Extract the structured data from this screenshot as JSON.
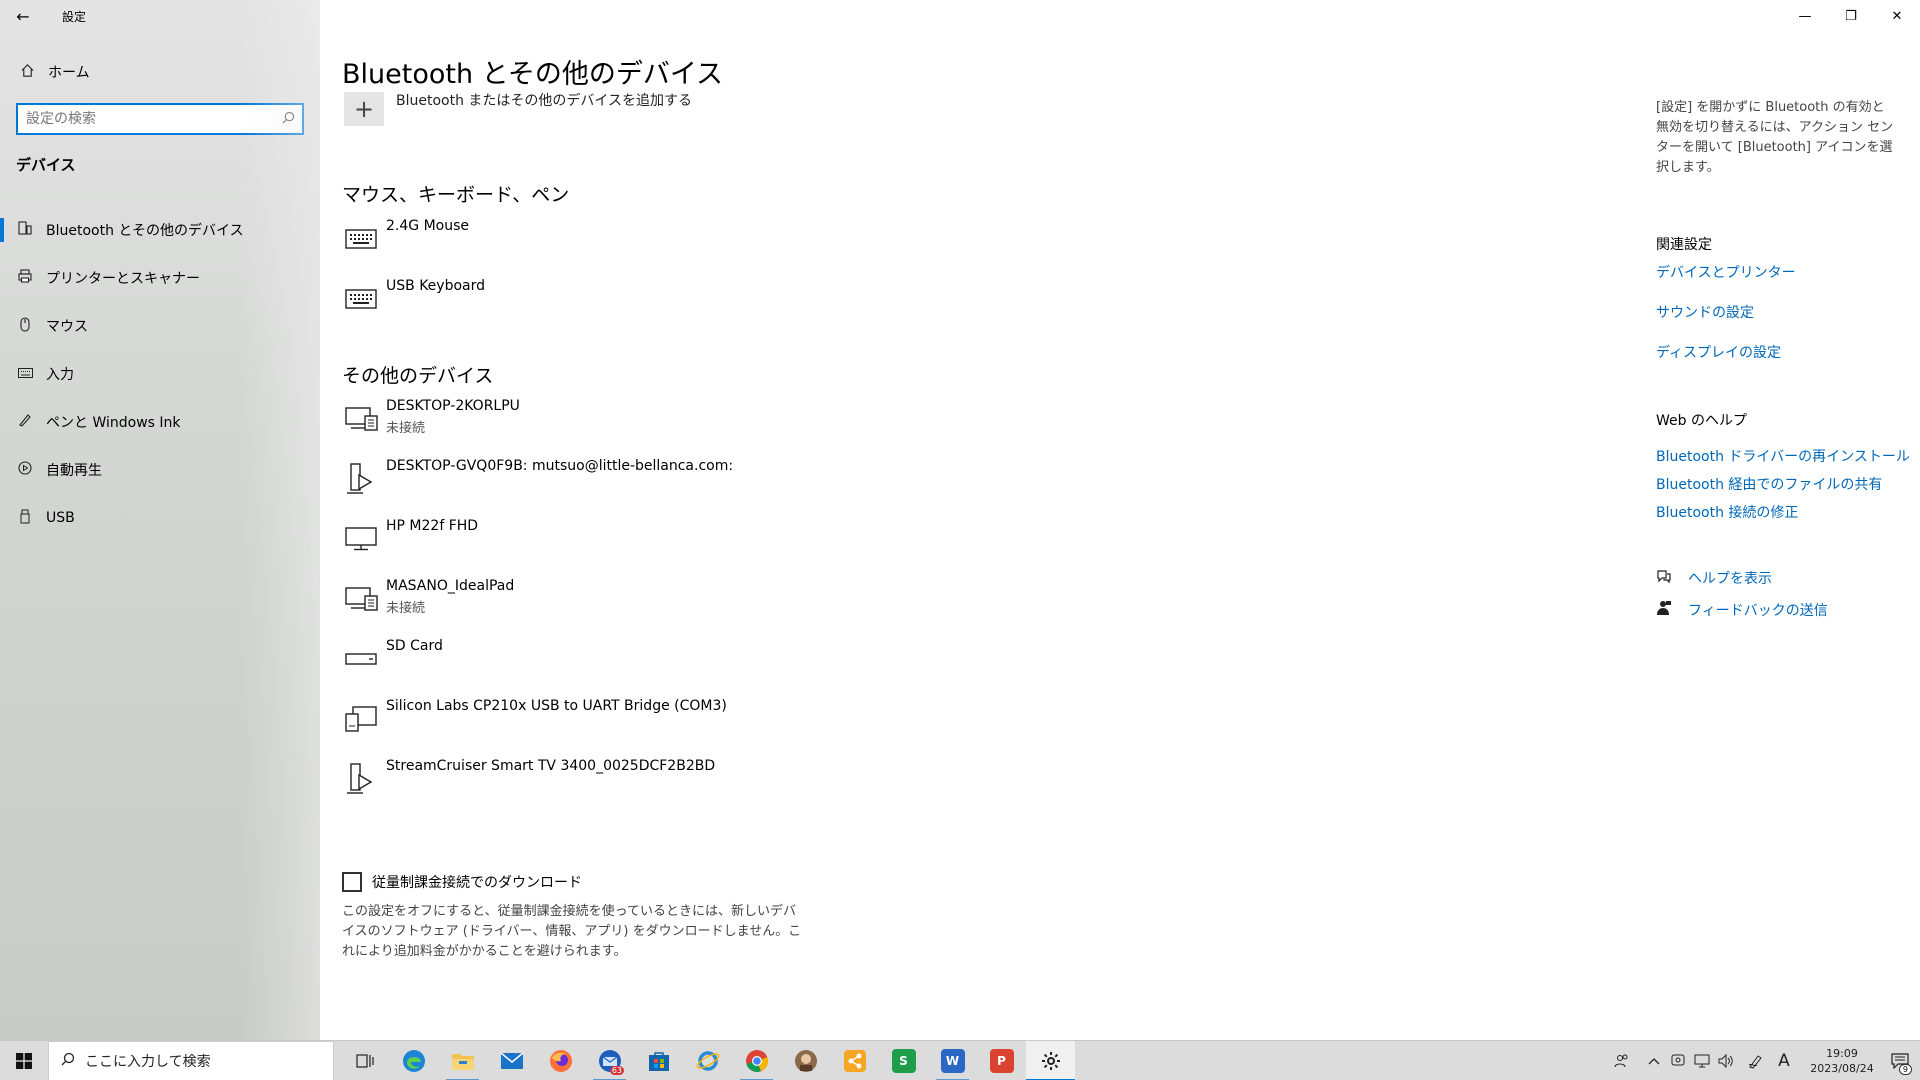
{
  "window": {
    "app_title": "設定",
    "back_icon": "←",
    "minimize_icon": "—",
    "restore_icon": "❐",
    "close_icon": "✕"
  },
  "sidebar": {
    "home_label": "ホーム",
    "search_placeholder": "設定の検索",
    "section_title": "デバイス",
    "items": [
      {
        "label": "Bluetooth とその他のデバイス",
        "icon": "bluetooth-devices-icon",
        "active": true
      },
      {
        "label": "プリンターとスキャナー",
        "icon": "printer-icon"
      },
      {
        "label": "マウス",
        "icon": "mouse-icon"
      },
      {
        "label": "入力",
        "icon": "keyboard-icon"
      },
      {
        "label": "ペンと Windows Ink",
        "icon": "pen-icon"
      },
      {
        "label": "自動再生",
        "icon": "autoplay-icon"
      },
      {
        "label": "USB",
        "icon": "usb-icon"
      }
    ]
  },
  "main": {
    "title": "Bluetooth とその他のデバイス",
    "add_label": "Bluetooth またはその他のデバイスを追加する",
    "mouse_section_title": "マウス、キーボード、ペン",
    "mouse_devices": [
      {
        "name": "2.4G Mouse",
        "status": "",
        "icon": "keyboard-icon"
      },
      {
        "name": "USB Keyboard",
        "status": "",
        "icon": "keyboard-icon"
      }
    ],
    "other_section_title": "その他のデバイス",
    "other_devices": [
      {
        "name": "DESKTOP-2KORLPU",
        "status": "未接続",
        "icon": "network-pc-icon"
      },
      {
        "name": "DESKTOP-GVQ0F9B: mutsuo@little-bellanca.com:",
        "status": "",
        "icon": "media-device-icon"
      },
      {
        "name": "HP M22f FHD",
        "status": "",
        "icon": "monitor-icon"
      },
      {
        "name": "MASANO_IdealPad",
        "status": "未接続",
        "icon": "network-pc-icon"
      },
      {
        "name": "SD Card",
        "status": "",
        "icon": "drive-icon"
      },
      {
        "name": "Silicon Labs CP210x USB to UART Bridge (COM3)",
        "status": "",
        "icon": "generic-device-icon"
      },
      {
        "name": "StreamCruiser Smart TV 3400_0025DCF2B2BD",
        "status": "",
        "icon": "media-device-icon"
      }
    ],
    "metered_label": "従量制課金接続でのダウンロード",
    "metered_desc": "この設定をオフにすると、従量制課金接続を使っているときには、新しいデバイスのソフトウェア (ドライバー、情報、アプリ) をダウンロードしません。これにより追加料金がかかることを避けられます。"
  },
  "right": {
    "info": "[設定] を開かずに Bluetooth の有効と無効を切り替えるには、アクション センターを開いて [Bluetooth] アイコンを選択します。",
    "related_title": "関連設定",
    "related_links": [
      "デバイスとプリンター",
      "サウンドの設定",
      "ディスプレイの設定"
    ],
    "web_help_title": "Web のヘルプ",
    "web_links": [
      "Bluetooth ドライバーの再インストール",
      "Bluetooth 経由でのファイルの共有",
      "Bluetooth 接続の修正"
    ],
    "help_link": "ヘルプを表示",
    "feedback_link": "フィードバックの送信"
  },
  "taskbar": {
    "search_text": "ここに入力して検索",
    "mail_badge": "63",
    "clock_time": "19:09",
    "clock_date": "2023/08/24",
    "ime_label": "A",
    "notification_count": "9",
    "colors": {
      "accent": "#0078d7",
      "link": "#0067b8"
    }
  }
}
